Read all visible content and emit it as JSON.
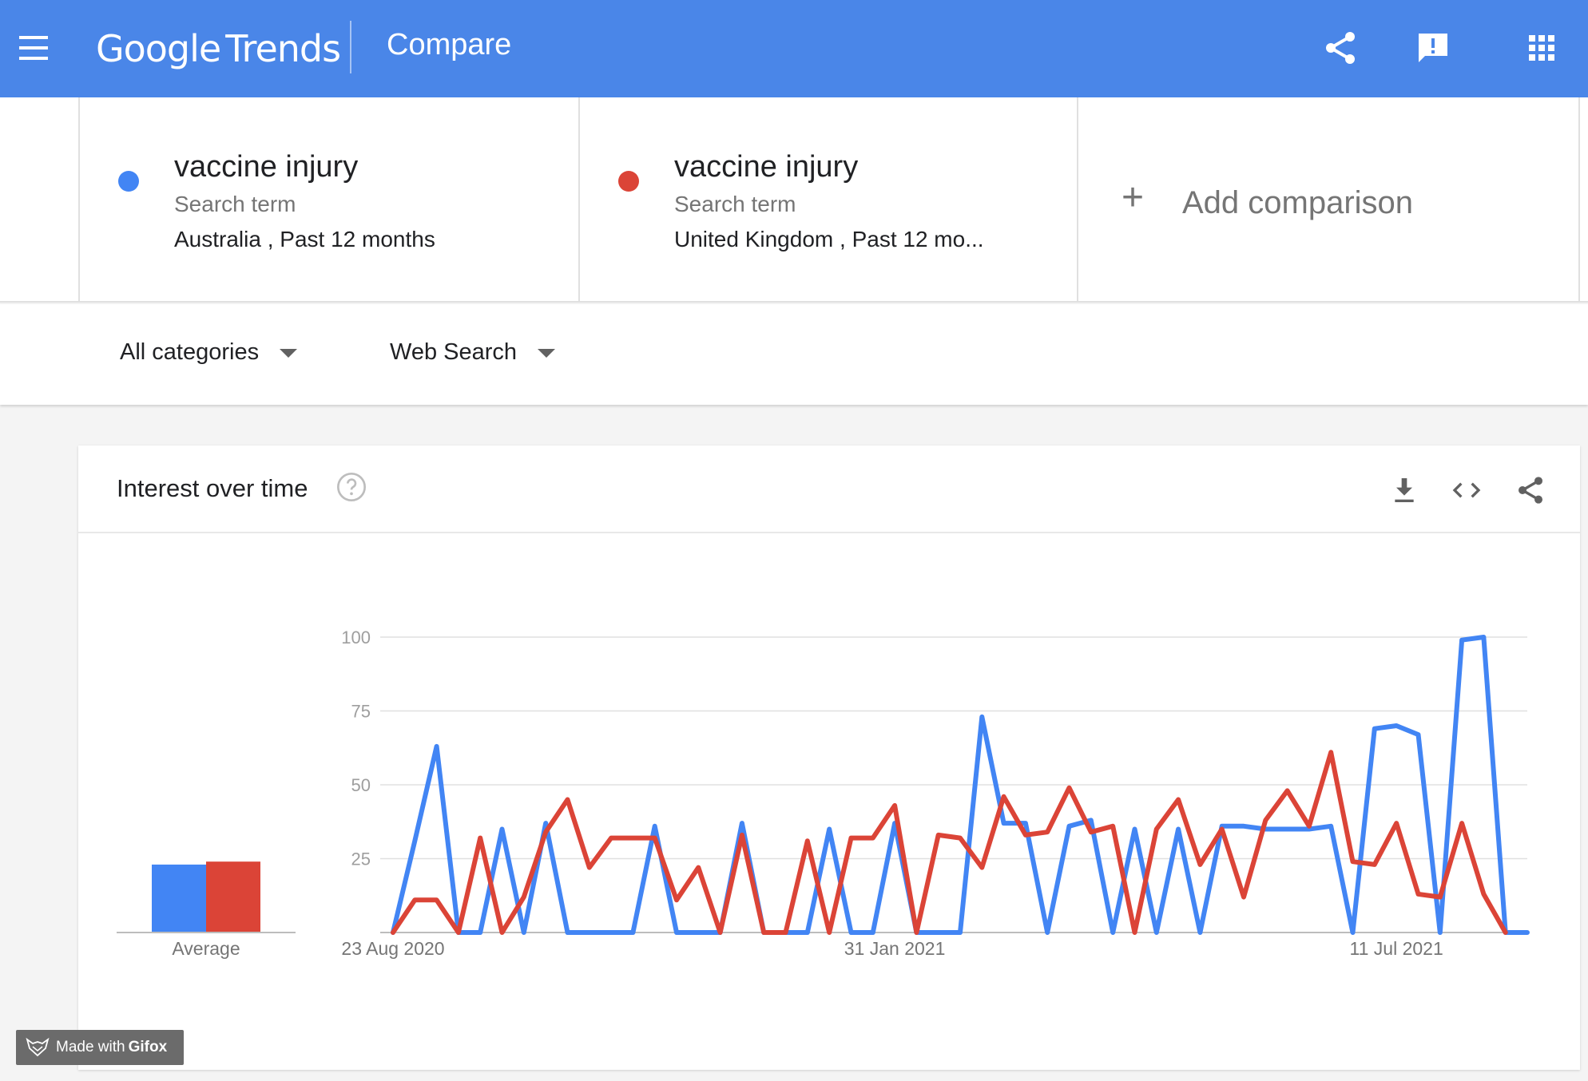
{
  "header": {
    "logo_google": "Google",
    "logo_trends": "Trends",
    "page_title": "Compare"
  },
  "terms": [
    {
      "name": "vaccine injury",
      "type": "Search term",
      "geo": "Australia , Past 12 months",
      "color": "#4285f4"
    },
    {
      "name": "vaccine injury",
      "type": "Search term",
      "geo": "United Kingdom , Past 12 mo...",
      "color": "#db4437"
    }
  ],
  "add_comparison": {
    "plus": "+",
    "label": "Add comparison"
  },
  "filters": {
    "category": "All categories",
    "search_type": "Web Search"
  },
  "widget": {
    "title": "Interest over time"
  },
  "icons": {
    "menu": "menu-icon",
    "share": "share-icon",
    "feedback": "feedback-icon",
    "apps": "apps-grid-icon",
    "help": "help-circle-icon",
    "download": "download-icon",
    "embed": "embed-code-icon",
    "widget_share": "share-icon"
  },
  "chart_data": {
    "type": "line",
    "title": "",
    "xlabel": "",
    "ylabel": "",
    "ylim": [
      0,
      100
    ],
    "yticks": [
      100,
      75,
      50,
      25
    ],
    "xtick_labels": [
      {
        "label": "23 Aug 2020",
        "index": 0
      },
      {
        "label": "31 Jan 2021",
        "index": 23
      },
      {
        "label": "11 Jul 2021",
        "index": 46
      }
    ],
    "grid": true,
    "series": [
      {
        "color": "#4285f4",
        "values": [
          0,
          31,
          63,
          0,
          0,
          35,
          0,
          37,
          0,
          0,
          0,
          0,
          36,
          0,
          0,
          0,
          37,
          0,
          0,
          0,
          35,
          0,
          0,
          37,
          0,
          0,
          0,
          73,
          37,
          37,
          0,
          36,
          38,
          0,
          35,
          0,
          35,
          0,
          36,
          36,
          35,
          35,
          35,
          36,
          0,
          69,
          70,
          67,
          0,
          99,
          100,
          0,
          0
        ]
      },
      {
        "color": "#db4437",
        "values": [
          0,
          11,
          11,
          0,
          32,
          0,
          12,
          34,
          45,
          22,
          32,
          32,
          32,
          11,
          22,
          0,
          33,
          0,
          0,
          31,
          0,
          32,
          32,
          43,
          0,
          33,
          32,
          22,
          46,
          33,
          34,
          49,
          34,
          36,
          0,
          35,
          45,
          23,
          35,
          12,
          38,
          48,
          36,
          61,
          24,
          23,
          37,
          13,
          12,
          37,
          13,
          0
        ]
      }
    ],
    "average": {
      "label": "Average",
      "values": [
        {
          "color": "#4285f4",
          "value": 23
        },
        {
          "color": "#db4437",
          "value": 24
        }
      ]
    }
  },
  "watermark": {
    "prefix": "Made with",
    "brand": "Gifox"
  }
}
